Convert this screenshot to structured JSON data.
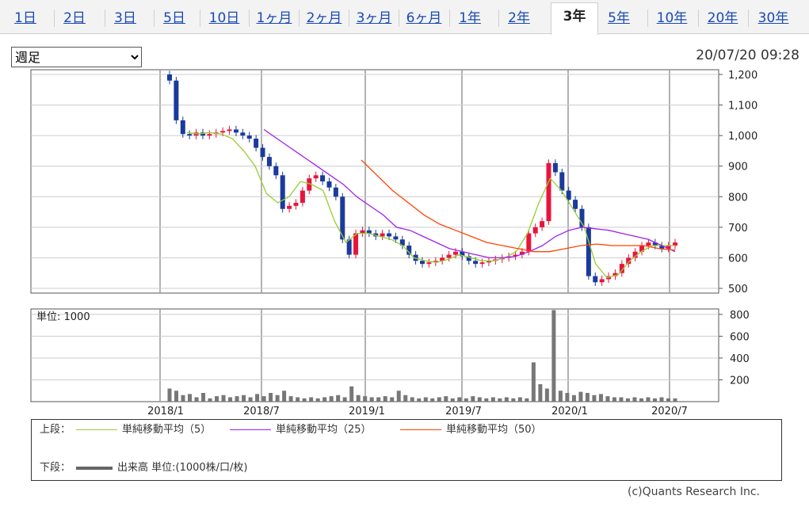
{
  "tabs": [
    {
      "label": "1日",
      "active": false
    },
    {
      "label": "2日",
      "active": false
    },
    {
      "label": "3日",
      "active": false
    },
    {
      "label": "5日",
      "active": false
    },
    {
      "label": "10日",
      "active": false
    },
    {
      "label": "1ヶ月",
      "active": false
    },
    {
      "label": "2ヶ月",
      "active": false
    },
    {
      "label": "3ヶ月",
      "active": false
    },
    {
      "label": "6ヶ月",
      "active": false
    },
    {
      "label": "1年",
      "active": false
    },
    {
      "label": "2年",
      "active": false
    },
    {
      "label": "3年",
      "active": true
    },
    {
      "label": "5年",
      "active": false
    },
    {
      "label": "10年",
      "active": false
    },
    {
      "label": "20年",
      "active": false
    },
    {
      "label": "30年",
      "active": false
    }
  ],
  "period_select": {
    "value": "週足",
    "options": [
      "週足"
    ]
  },
  "timestamp": "20/07/20 09:28",
  "colors": {
    "up": "#e8143c",
    "down": "#1a3a9c",
    "ma5": "#9acd32",
    "ma25": "#a020f0",
    "ma50": "#ff4500",
    "volume": "#777777",
    "grid": "#999999"
  },
  "chart_data": [
    {
      "type": "candlestick",
      "x_ticks": [
        "2018/1",
        "2018/7",
        "2019/1",
        "2019/7",
        "2020/1",
        "2020/7"
      ],
      "y_ticks": [
        "1,200",
        "1,100",
        "1,000",
        "900",
        "800",
        "700",
        "600",
        "500"
      ],
      "ylim": [
        500,
        1200
      ],
      "grid": true,
      "weekly_close_approx": [
        1180,
        1050,
        1005,
        1000,
        1010,
        1000,
        1005,
        1010,
        1015,
        1020,
        1010,
        1000,
        990,
        960,
        930,
        900,
        870,
        760,
        770,
        780,
        820,
        860,
        870,
        850,
        830,
        800,
        660,
        610,
        680,
        690,
        680,
        670,
        680,
        670,
        660,
        640,
        610,
        590,
        580,
        585,
        590,
        600,
        610,
        620,
        605,
        590,
        580,
        585,
        590,
        595,
        600,
        605,
        610,
        620,
        680,
        700,
        720,
        910,
        880,
        820,
        790,
        760,
        700,
        540,
        520,
        530,
        540,
        550,
        580,
        600,
        620,
        640,
        650,
        640,
        630,
        640,
        650
      ],
      "series": [
        {
          "name": "単純移動平均（5）",
          "values": [
            1010,
            1005,
            1010,
            1005,
            990,
            950,
            900,
            810,
            780,
            800,
            850,
            840,
            820,
            720,
            650,
            680,
            680,
            670,
            660,
            640,
            600,
            590,
            585,
            595,
            610,
            600,
            590,
            590,
            600,
            620,
            680,
            780,
            860,
            820,
            760,
            700,
            580,
            535,
            545,
            590,
            620,
            640,
            640,
            640
          ]
        },
        {
          "name": "単純移動平均（25）",
          "values": [
            1020,
            990,
            960,
            930,
            900,
            870,
            840,
            800,
            770,
            740,
            700,
            690,
            670,
            650,
            630,
            620,
            610,
            600,
            600,
            605,
            620,
            640,
            670,
            690,
            700,
            695,
            690,
            680,
            670,
            660,
            640,
            620
          ]
        },
        {
          "name": "単純移動平均（50）",
          "values": [
            920,
            870,
            820,
            780,
            740,
            710,
            690,
            670,
            650,
            640,
            630,
            620,
            620,
            630,
            640,
            645,
            640,
            640,
            640,
            630,
            625
          ]
        }
      ]
    },
    {
      "type": "bar",
      "name": "出来高",
      "y_ticks": [
        "800",
        "600",
        "400",
        "200"
      ],
      "ylim": [
        0,
        850
      ],
      "unit_label": "単位: 1000",
      "values": [
        120,
        100,
        60,
        70,
        40,
        80,
        30,
        50,
        60,
        40,
        50,
        60,
        40,
        70,
        50,
        80,
        60,
        100,
        50,
        40,
        30,
        40,
        30,
        40,
        50,
        60,
        40,
        140,
        60,
        50,
        40,
        40,
        50,
        40,
        100,
        60,
        40,
        30,
        40,
        30,
        40,
        50,
        30,
        40,
        30,
        50,
        40,
        30,
        40,
        30,
        40,
        30,
        40,
        30,
        360,
        160,
        120,
        840,
        100,
        80,
        60,
        90,
        80,
        60,
        70,
        50,
        40,
        40,
        30,
        40,
        30,
        40,
        30,
        40,
        30,
        30
      ]
    }
  ],
  "legend": {
    "upper_label": "上段：",
    "lower_label": "下段：",
    "ma5": "単純移動平均（5）",
    "ma25": "単純移動平均（25）",
    "ma50": "単純移動平均（50）",
    "volume": "出来高 単位:(1000株/口/枚)"
  },
  "credit": "(c)Quants Research Inc."
}
